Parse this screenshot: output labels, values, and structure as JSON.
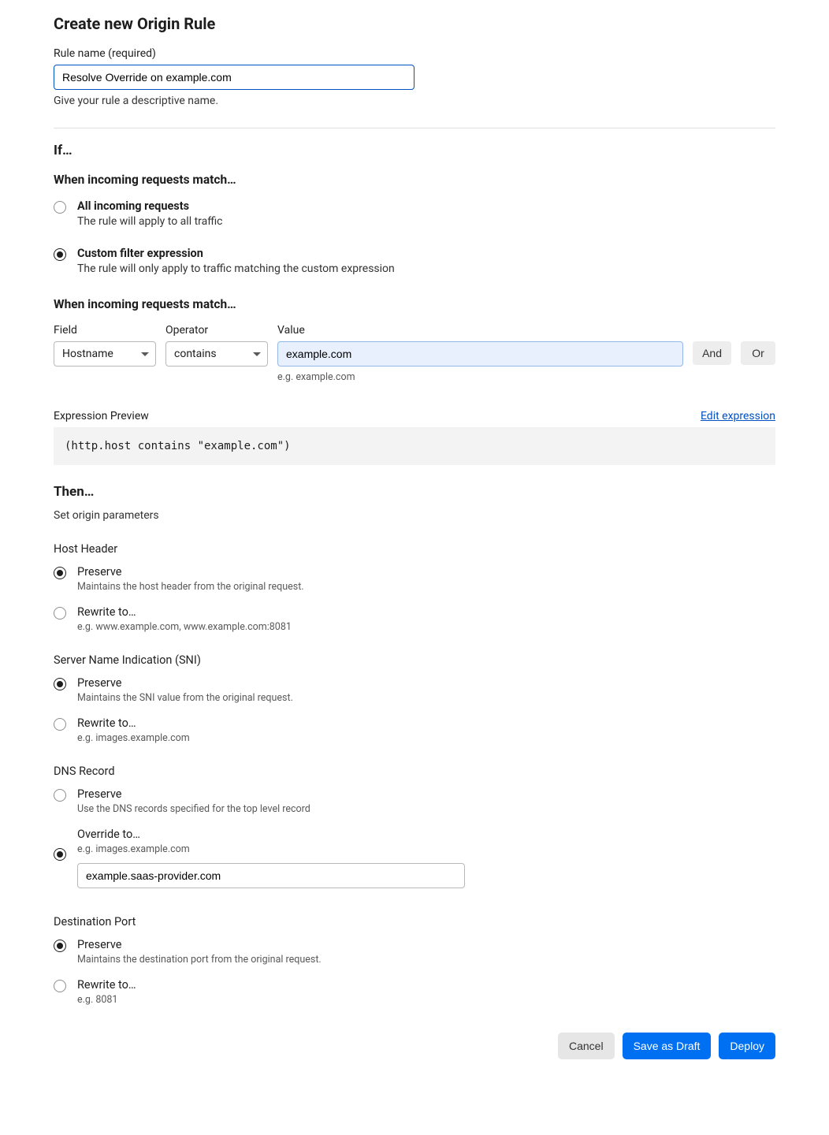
{
  "title": "Create new Origin Rule",
  "ruleName": {
    "label": "Rule name (required)",
    "value": "Resolve Override on example.com",
    "helper": "Give your rule a descriptive name."
  },
  "if": {
    "heading": "If…",
    "matchHeading": "When incoming requests match…",
    "options": {
      "all": {
        "title": "All incoming requests",
        "desc": "The rule will apply to all traffic"
      },
      "custom": {
        "title": "Custom filter expression",
        "desc": "The rule will only apply to traffic matching the custom expression"
      }
    },
    "builderHeading": "When incoming requests match…",
    "builder": {
      "fieldLabel": "Field",
      "operatorLabel": "Operator",
      "valueLabel": "Value",
      "field": "Hostname",
      "operator": "contains",
      "value": "example.com",
      "valueHint": "e.g. example.com",
      "andLabel": "And",
      "orLabel": "Or"
    },
    "preview": {
      "label": "Expression Preview",
      "editLink": "Edit expression",
      "code": "(http.host contains \"example.com\")"
    }
  },
  "then": {
    "heading": "Then…",
    "sub": "Set origin parameters",
    "hostHeader": {
      "title": "Host Header",
      "preserve": {
        "title": "Preserve",
        "desc": "Maintains the host header from the original request."
      },
      "rewrite": {
        "title": "Rewrite to…",
        "desc": "e.g. www.example.com, www.example.com:8081"
      }
    },
    "sni": {
      "title": "Server Name Indication (SNI)",
      "preserve": {
        "title": "Preserve",
        "desc": "Maintains the SNI value from the original request."
      },
      "rewrite": {
        "title": "Rewrite to…",
        "desc": "e.g. images.example.com"
      }
    },
    "dns": {
      "title": "DNS Record",
      "preserve": {
        "title": "Preserve",
        "desc": "Use the DNS records specified for the top level record"
      },
      "override": {
        "title": "Override to…",
        "desc": "e.g. images.example.com",
        "value": "example.saas-provider.com"
      }
    },
    "port": {
      "title": "Destination Port",
      "preserve": {
        "title": "Preserve",
        "desc": "Maintains the destination port from the original request."
      },
      "rewrite": {
        "title": "Rewrite to…",
        "desc": "e.g. 8081"
      }
    }
  },
  "footer": {
    "cancel": "Cancel",
    "draft": "Save as Draft",
    "deploy": "Deploy"
  }
}
